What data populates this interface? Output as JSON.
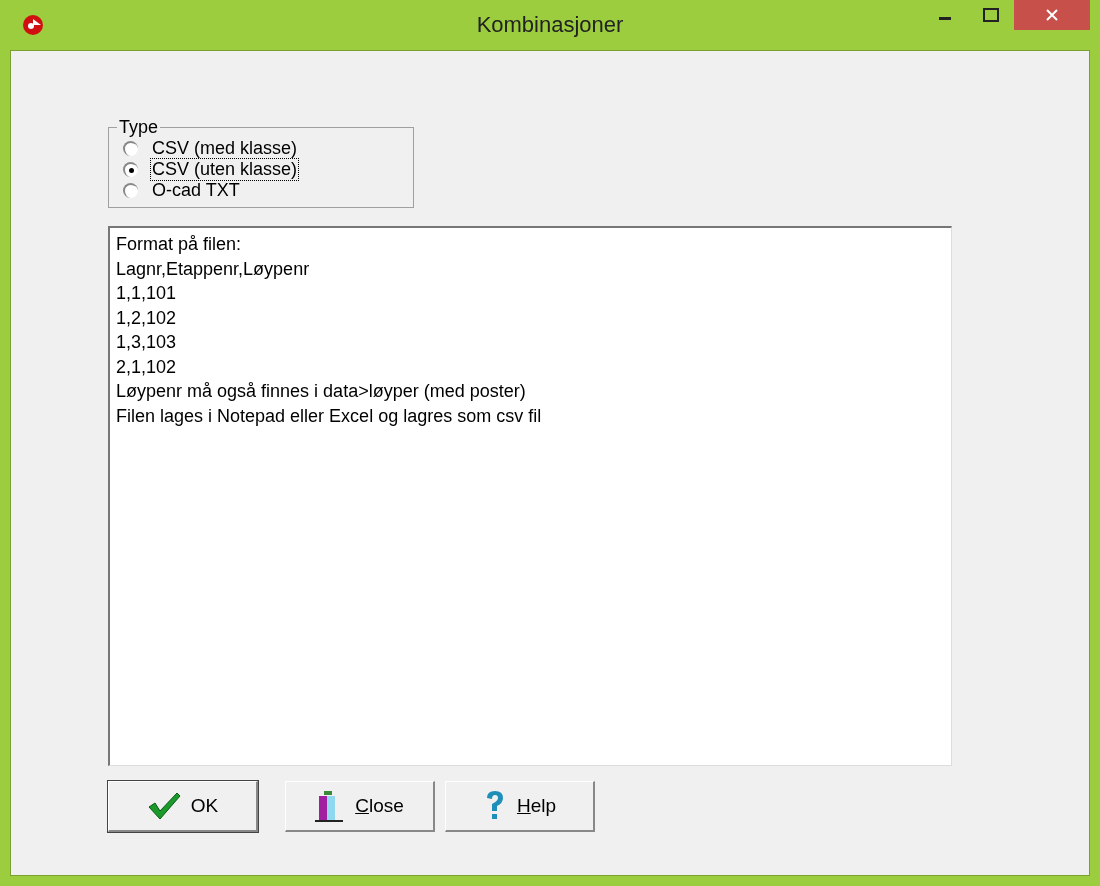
{
  "window": {
    "title": "Kombinasjoner"
  },
  "type_group": {
    "label": "Type",
    "options": [
      {
        "label": "CSV (med klasse)",
        "selected": false
      },
      {
        "label": "CSV (uten klasse)",
        "selected": true
      },
      {
        "label": "O-cad TXT",
        "selected": false
      }
    ]
  },
  "memo": {
    "lines": [
      "Format på filen:",
      "Lagnr,Etappenr,Løypenr",
      "1,1,101",
      "1,2,102",
      "1,3,103",
      "2,1,102",
      "Løypenr må også finnes i data>løyper (med poster)",
      "Filen lages i Notepad eller Excel og lagres som csv fil"
    ]
  },
  "buttons": [
    {
      "kind": "ok",
      "label": "OK",
      "default": true,
      "underline_first": false
    },
    {
      "kind": "close",
      "label": "Close",
      "default": false,
      "underline_first": true
    },
    {
      "kind": "help",
      "label": "Help",
      "default": false,
      "underline_first": true
    }
  ]
}
